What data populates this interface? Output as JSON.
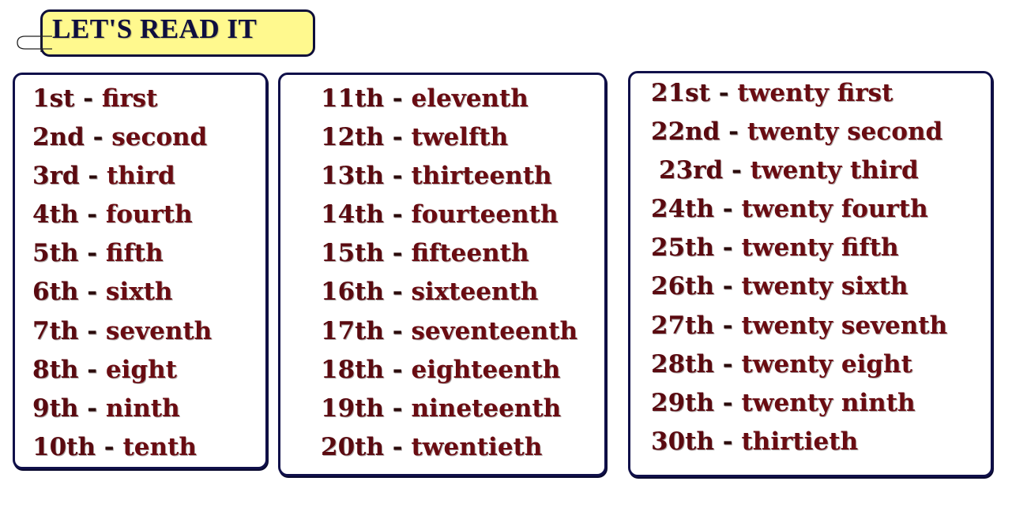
{
  "title": "LET'S READ IT",
  "colors": {
    "title_bg": "#fff98e",
    "border": "#10104a",
    "text": "#6a0c12"
  },
  "icons": {
    "clip": "paperclip-icon"
  },
  "columns": [
    {
      "items": [
        {
          "ordinal": "1st",
          "word": "first"
        },
        {
          "ordinal": "2nd",
          "word": "second"
        },
        {
          "ordinal": "3rd",
          "word": "third"
        },
        {
          "ordinal": "4th",
          "word": "fourth"
        },
        {
          "ordinal": "5th",
          "word": "fifth"
        },
        {
          "ordinal": "6th",
          "word": "sixth"
        },
        {
          "ordinal": "7th",
          "word": "seventh"
        },
        {
          "ordinal": "8th",
          "word": "eight"
        },
        {
          "ordinal": "9th",
          "word": "ninth"
        },
        {
          "ordinal": "10th",
          "word": "tenth"
        }
      ]
    },
    {
      "items": [
        {
          "ordinal": "11th",
          "word": "eleventh"
        },
        {
          "ordinal": "12th",
          "word": "twelfth"
        },
        {
          "ordinal": "13th",
          "word": "thirteenth"
        },
        {
          "ordinal": "14th",
          "word": "fourteenth"
        },
        {
          "ordinal": "15th",
          "word": "fifteenth"
        },
        {
          "ordinal": "16th",
          "word": "sixteenth"
        },
        {
          "ordinal": "17th",
          "word": "seventeenth"
        },
        {
          "ordinal": "18th",
          "word": "eighteenth"
        },
        {
          "ordinal": "19th",
          "word": "nineteenth"
        },
        {
          "ordinal": "20th",
          "word": "twentieth"
        }
      ]
    },
    {
      "items": [
        {
          "ordinal": "21st",
          "word": "twenty first"
        },
        {
          "ordinal": "22nd",
          "word": "twenty second"
        },
        {
          "ordinal": "23rd",
          "word": "twenty third"
        },
        {
          "ordinal": "24th",
          "word": "twenty fourth"
        },
        {
          "ordinal": "25th",
          "word": "twenty fifth"
        },
        {
          "ordinal": "26th",
          "word": "twenty sixth"
        },
        {
          "ordinal": "27th",
          "word": "twenty seventh"
        },
        {
          "ordinal": "28th",
          "word": "twenty eight"
        },
        {
          "ordinal": "29th",
          "word": "twenty ninth"
        },
        {
          "ordinal": "30th",
          "word": "thirtieth"
        }
      ]
    }
  ],
  "separator": "-"
}
